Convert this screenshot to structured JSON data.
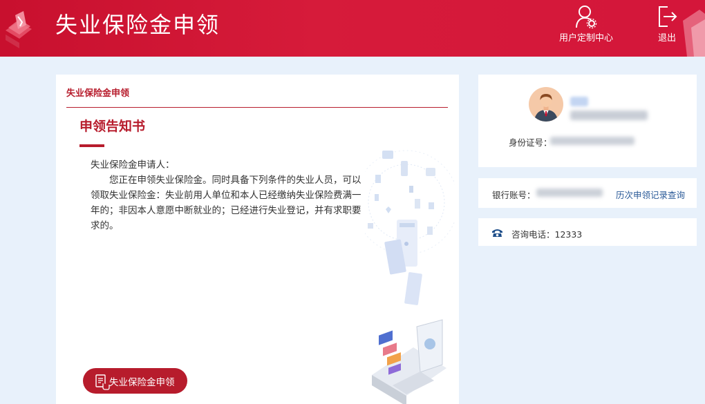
{
  "header": {
    "title": "失业保险金申领",
    "custom_center_label": "用户定制中心",
    "exit_label": "退出"
  },
  "main": {
    "breadcrumb": "失业保险金申领",
    "notice_title": "申领告知书",
    "salutation": "失业保险金申请人：",
    "body": "您正在申领失业保险金。同时具备下列条件的失业人员，可以领取失业保险金：失业前用人单位和本人已经缴纳失业保险费满一年的；非因本人意愿中断就业的；已经进行失业登记，并有求职要求的。",
    "apply_button": "失业保险金申领"
  },
  "profile": {
    "id_label": "身份证号："
  },
  "bank": {
    "label": "银行账号：",
    "history_link": "历次申领记录查询"
  },
  "hotline": {
    "text": "咨询电话：12333"
  },
  "colors": {
    "brand_red": "#c8102e",
    "accent_red": "#b71c2c",
    "link_blue": "#2a5a98",
    "page_bg": "#e8f1fb"
  }
}
